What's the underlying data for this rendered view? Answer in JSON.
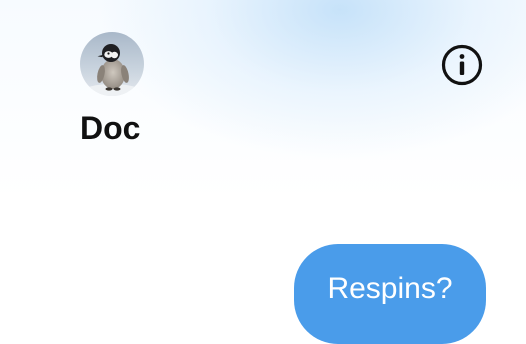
{
  "contact": {
    "name": "Doc",
    "avatar_icon": "penguin-avatar"
  },
  "header": {
    "info_icon": "info-icon"
  },
  "messages": [
    {
      "direction": "outgoing",
      "text": "Respins?",
      "bubble_color": "#4a9cea"
    }
  ],
  "colors": {
    "accent": "#4a9cea",
    "name_text": "#111111"
  }
}
